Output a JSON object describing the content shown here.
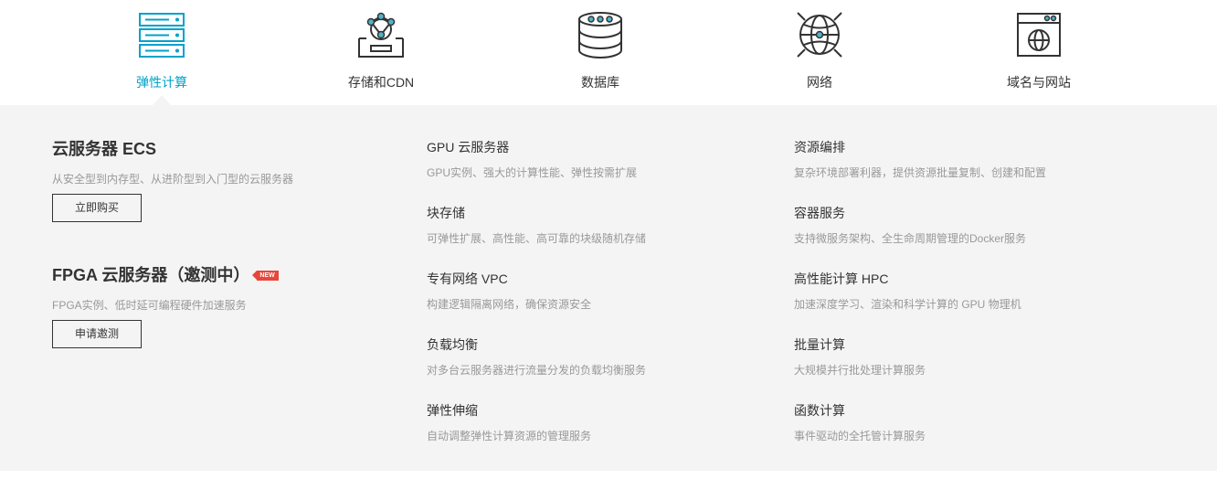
{
  "tabs": [
    {
      "label": "弹性计算",
      "icon": "server-rack-icon",
      "active": true
    },
    {
      "label": "存储和CDN",
      "icon": "storage-cdn-icon",
      "active": false
    },
    {
      "label": "数据库",
      "icon": "database-icon",
      "active": false
    },
    {
      "label": "网络",
      "icon": "network-globe-icon",
      "active": false
    },
    {
      "label": "域名与网站",
      "icon": "website-icon",
      "active": false
    }
  ],
  "colors": {
    "accent": "#00a2ca",
    "panel_bg": "#f4f4f4",
    "badge": "#e8463a"
  },
  "featured": [
    {
      "title": "云服务器 ECS",
      "desc": "从安全型到内存型、从进阶型到入门型的云服务器",
      "button": "立即购买"
    },
    {
      "title": "FPGA 云服务器（邀测中）",
      "badge": "NEW",
      "desc": "FPGA实例、低时延可编程硬件加速服务",
      "button": "申请邀测"
    }
  ],
  "services_col1": [
    {
      "title": "GPU 云服务器",
      "desc": "GPU实例、强大的计算性能、弹性按需扩展"
    },
    {
      "title": "块存储",
      "desc": "可弹性扩展、高性能、高可靠的块级随机存储"
    },
    {
      "title": "专有网络 VPC",
      "desc": "构建逻辑隔离网络，确保资源安全"
    },
    {
      "title": "负载均衡",
      "desc": "对多台云服务器进行流量分发的负载均衡服务"
    },
    {
      "title": "弹性伸缩",
      "desc": "自动调整弹性计算资源的管理服务"
    }
  ],
  "services_col2": [
    {
      "title": "资源编排",
      "desc": "复杂环境部署利器，提供资源批量复制、创建和配置"
    },
    {
      "title": "容器服务",
      "desc": "支持微服务架构、全生命周期管理的Docker服务"
    },
    {
      "title": "高性能计算 HPC",
      "desc": "加速深度学习、渲染和科学计算的 GPU 物理机"
    },
    {
      "title": "批量计算",
      "desc": "大规模并行批处理计算服务"
    },
    {
      "title": "函数计算",
      "desc": "事件驱动的全托管计算服务"
    }
  ]
}
